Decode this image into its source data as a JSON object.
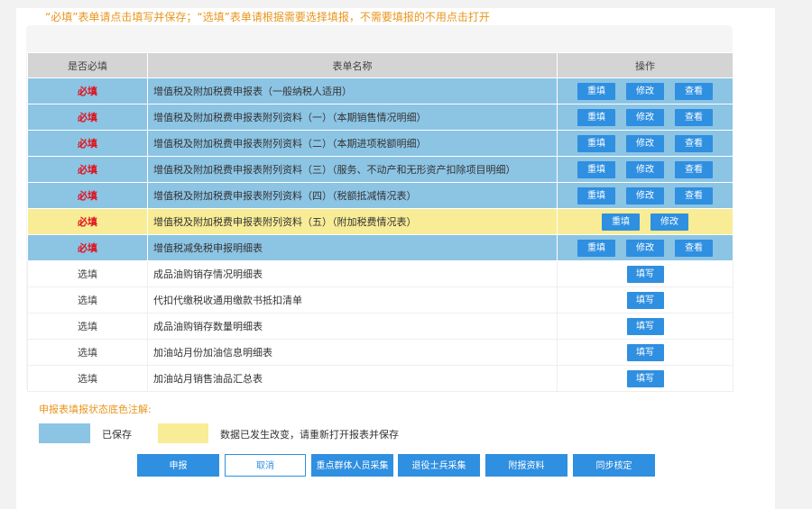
{
  "notice": "“必填”表单请点击填写并保存；“选填”表单请根据需要选择填报，不需要填报的不用点击打开",
  "table": {
    "headers": [
      "是否必填",
      "表单名称",
      "操作"
    ],
    "required_rows": [
      {
        "req": "必填",
        "name": "增值税及附加税费申报表（一般纳税人适用）",
        "status": "saved",
        "ops": [
          "重填",
          "修改",
          "查看"
        ]
      },
      {
        "req": "必填",
        "name": "增值税及附加税费申报表附列资料（一）（本期销售情况明细）",
        "status": "saved",
        "ops": [
          "重填",
          "修改",
          "查看"
        ]
      },
      {
        "req": "必填",
        "name": "增值税及附加税费申报表附列资料（二）（本期进项税额明细）",
        "status": "saved",
        "ops": [
          "重填",
          "修改",
          "查看"
        ]
      },
      {
        "req": "必填",
        "name": "增值税及附加税费申报表附列资料（三）（服务、不动产和无形资产扣除项目明细）",
        "status": "saved",
        "ops": [
          "重填",
          "修改",
          "查看"
        ]
      },
      {
        "req": "必填",
        "name": "增值税及附加税费申报表附列资料（四）（税额抵减情况表）",
        "status": "saved",
        "ops": [
          "重填",
          "修改",
          "查看"
        ]
      },
      {
        "req": "必填",
        "name": "增值税及附加税费申报表附列资料（五）（附加税费情况表）",
        "status": "changed",
        "ops": [
          "重填",
          "修改"
        ]
      },
      {
        "req": "必填",
        "name": "增值税减免税申报明细表",
        "status": "saved",
        "ops": [
          "重填",
          "修改",
          "查看"
        ]
      }
    ],
    "optional_rows": [
      {
        "req": "选填",
        "name": "成品油购销存情况明细表",
        "op": "填写"
      },
      {
        "req": "选填",
        "name": "代扣代缴税收通用缴款书抵扣清单",
        "op": "填写"
      },
      {
        "req": "选填",
        "name": "成品油购销存数量明细表",
        "op": "填写"
      },
      {
        "req": "选填",
        "name": "加油站月份加油信息明细表",
        "op": "填写"
      },
      {
        "req": "选填",
        "name": "加油站月销售油品汇总表",
        "op": "填写"
      }
    ]
  },
  "legend": {
    "title": "申报表填报状态底色注解:",
    "saved_label": "已保存",
    "changed_label": "数据已发生改变，请重新打开报表并保存"
  },
  "buttons": {
    "submit": "申报",
    "cancel": "取消",
    "key_group": "重点群体人员采集",
    "veteran": "退役士兵采集",
    "attach": "附报资料",
    "sync": "同步核定"
  },
  "colors": {
    "saved": "#8cc4e4",
    "changed": "#f8ec96",
    "required_text": "#e0101a",
    "notice_text": "#e8951c",
    "button": "#2f8fe0"
  }
}
